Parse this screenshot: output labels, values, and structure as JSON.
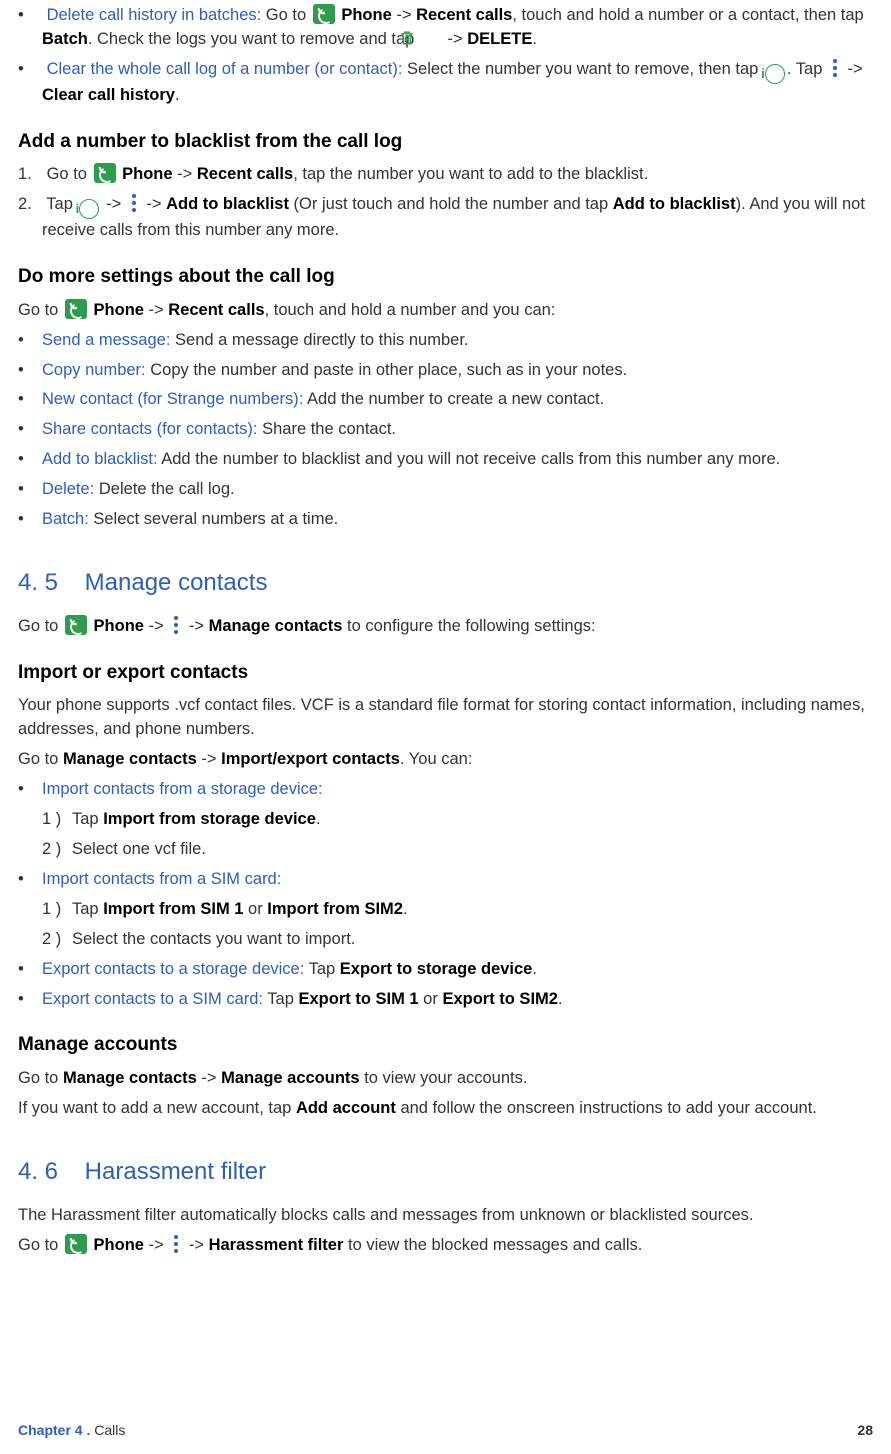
{
  "top": {
    "r1": {
      "title": "Delete call history in batches:",
      "t1": " Go to ",
      "phone": "Phone",
      "arr1": " -> ",
      "recent": "Recent calls",
      "t2": ", touch and hold a number or a contact, then tap ",
      "batch": "Batch",
      "t3": ". Check the logs you want to remove and tap ",
      "arr2": " -> ",
      "del": "DELETE",
      "t4": "."
    },
    "r2": {
      "title": "Clear the whole call log of a number (or contact):",
      "t1": " Select the number you want to remove, then tap ",
      "t2": ". Tap ",
      "arr": " -> ",
      "clr": "Clear call history",
      "t3": "."
    }
  },
  "h1": "Add a number to blacklist from the call log",
  "bl1": {
    "r1": {
      "t1": "Go to ",
      "phone": "Phone",
      "arr": " -> ",
      "recent": "Recent calls",
      "t2": ", tap the number you want to add to the blacklist."
    },
    "r2": {
      "t1": "Tap  ",
      "arr1": " -> ",
      "arr2": " -> ",
      "add": "Add to blacklist",
      "t2": " (Or just touch and hold the number and tap ",
      "add2": "Add to blacklist",
      "t3": "). And you will not receive calls from this number any more."
    }
  },
  "h2": "Do more settings about the call log",
  "p2": {
    "t1": "Go to ",
    "phone": "Phone",
    "arr": " -> ",
    "recent": "Recent calls",
    "t2": ", touch and hold a number and you can:"
  },
  "more": [
    {
      "k": "Send a message:",
      "v": " Send a message directly to this number."
    },
    {
      "k": "Copy number:",
      "v": " Copy the number and paste in other place, such as in your notes."
    },
    {
      "k": "New contact (for Strange numbers):",
      "v": " Add the number to create a new contact."
    },
    {
      "k": "Share contacts (for contacts):",
      "v": " Share the contact."
    },
    {
      "k": "Add to blacklist:",
      "v": " Add the number to blacklist and you will not receive calls from this number any more."
    },
    {
      "k": "Delete:",
      "v": " Delete the call log."
    },
    {
      "k": "Batch:",
      "v": " Select several numbers at a time."
    }
  ],
  "sec45": {
    "num": "4. 5",
    "title": "Manage contacts"
  },
  "p45": {
    "t1": "Go to ",
    "phone": "Phone",
    "arr1": " -> ",
    "arr2": " -> ",
    "mc": "Manage contacts",
    "t2": " to configure the following settings:"
  },
  "h3": "Import or export contacts",
  "p3a": "Your phone supports .vcf contact files. VCF is a standard file format for storing contact information, including names, addresses, and phone numbers.",
  "p3b": {
    "t1": "Go to ",
    "mc": "Manage contacts",
    "arr": " -> ",
    "ie": "Import/export contacts",
    "t2": ". You can:"
  },
  "imp1": {
    "title": "Import contacts from a storage device:",
    "s1a": "Tap ",
    "s1b": "Import from storage device",
    "s1c": ".",
    "s2": "Select one vcf file."
  },
  "imp2": {
    "title": "Import contacts from a SIM card:",
    "s1a": "Tap ",
    "s1b": "Import from SIM 1",
    "s1c": " or ",
    "s1d": "Import from SIM2",
    "s1e": ".",
    "s2": "Select the contacts you want to import."
  },
  "exp1": {
    "k": "Export contacts to a storage device:",
    "t1": " Tap ",
    "b": "Export to storage device",
    "t2": "."
  },
  "exp2": {
    "k": "Export contacts to a SIM card:",
    "t1": " Tap ",
    "b1": "Export to SIM 1",
    "or": " or ",
    "b2": "Export to SIM2",
    "t2": "."
  },
  "h4": "Manage accounts",
  "p4a": {
    "t1": "Go to ",
    "mc": "Manage contacts",
    "arr": " -> ",
    "ma": "Manage accounts",
    "t2": " to view your accounts."
  },
  "p4b": {
    "t1": "If you want to add a new account, tap ",
    "aa": "Add account",
    "t2": " and follow the onscreen instructions to add your account."
  },
  "sec46": {
    "num": "4. 6",
    "title": "Harassment filter"
  },
  "p46a": "The Harassment filter automatically blocks calls and messages from unknown or blacklisted sources.",
  "p46b": {
    "t1": "Go to ",
    "phone": "Phone",
    "arr1": " -> ",
    "arr2": " -> ",
    "hf": "Harassment filter",
    "t2": " to view the blocked messages and calls."
  },
  "footer": {
    "ch": "Chapter 4 .",
    "title": "  Calls",
    "page": "28"
  }
}
